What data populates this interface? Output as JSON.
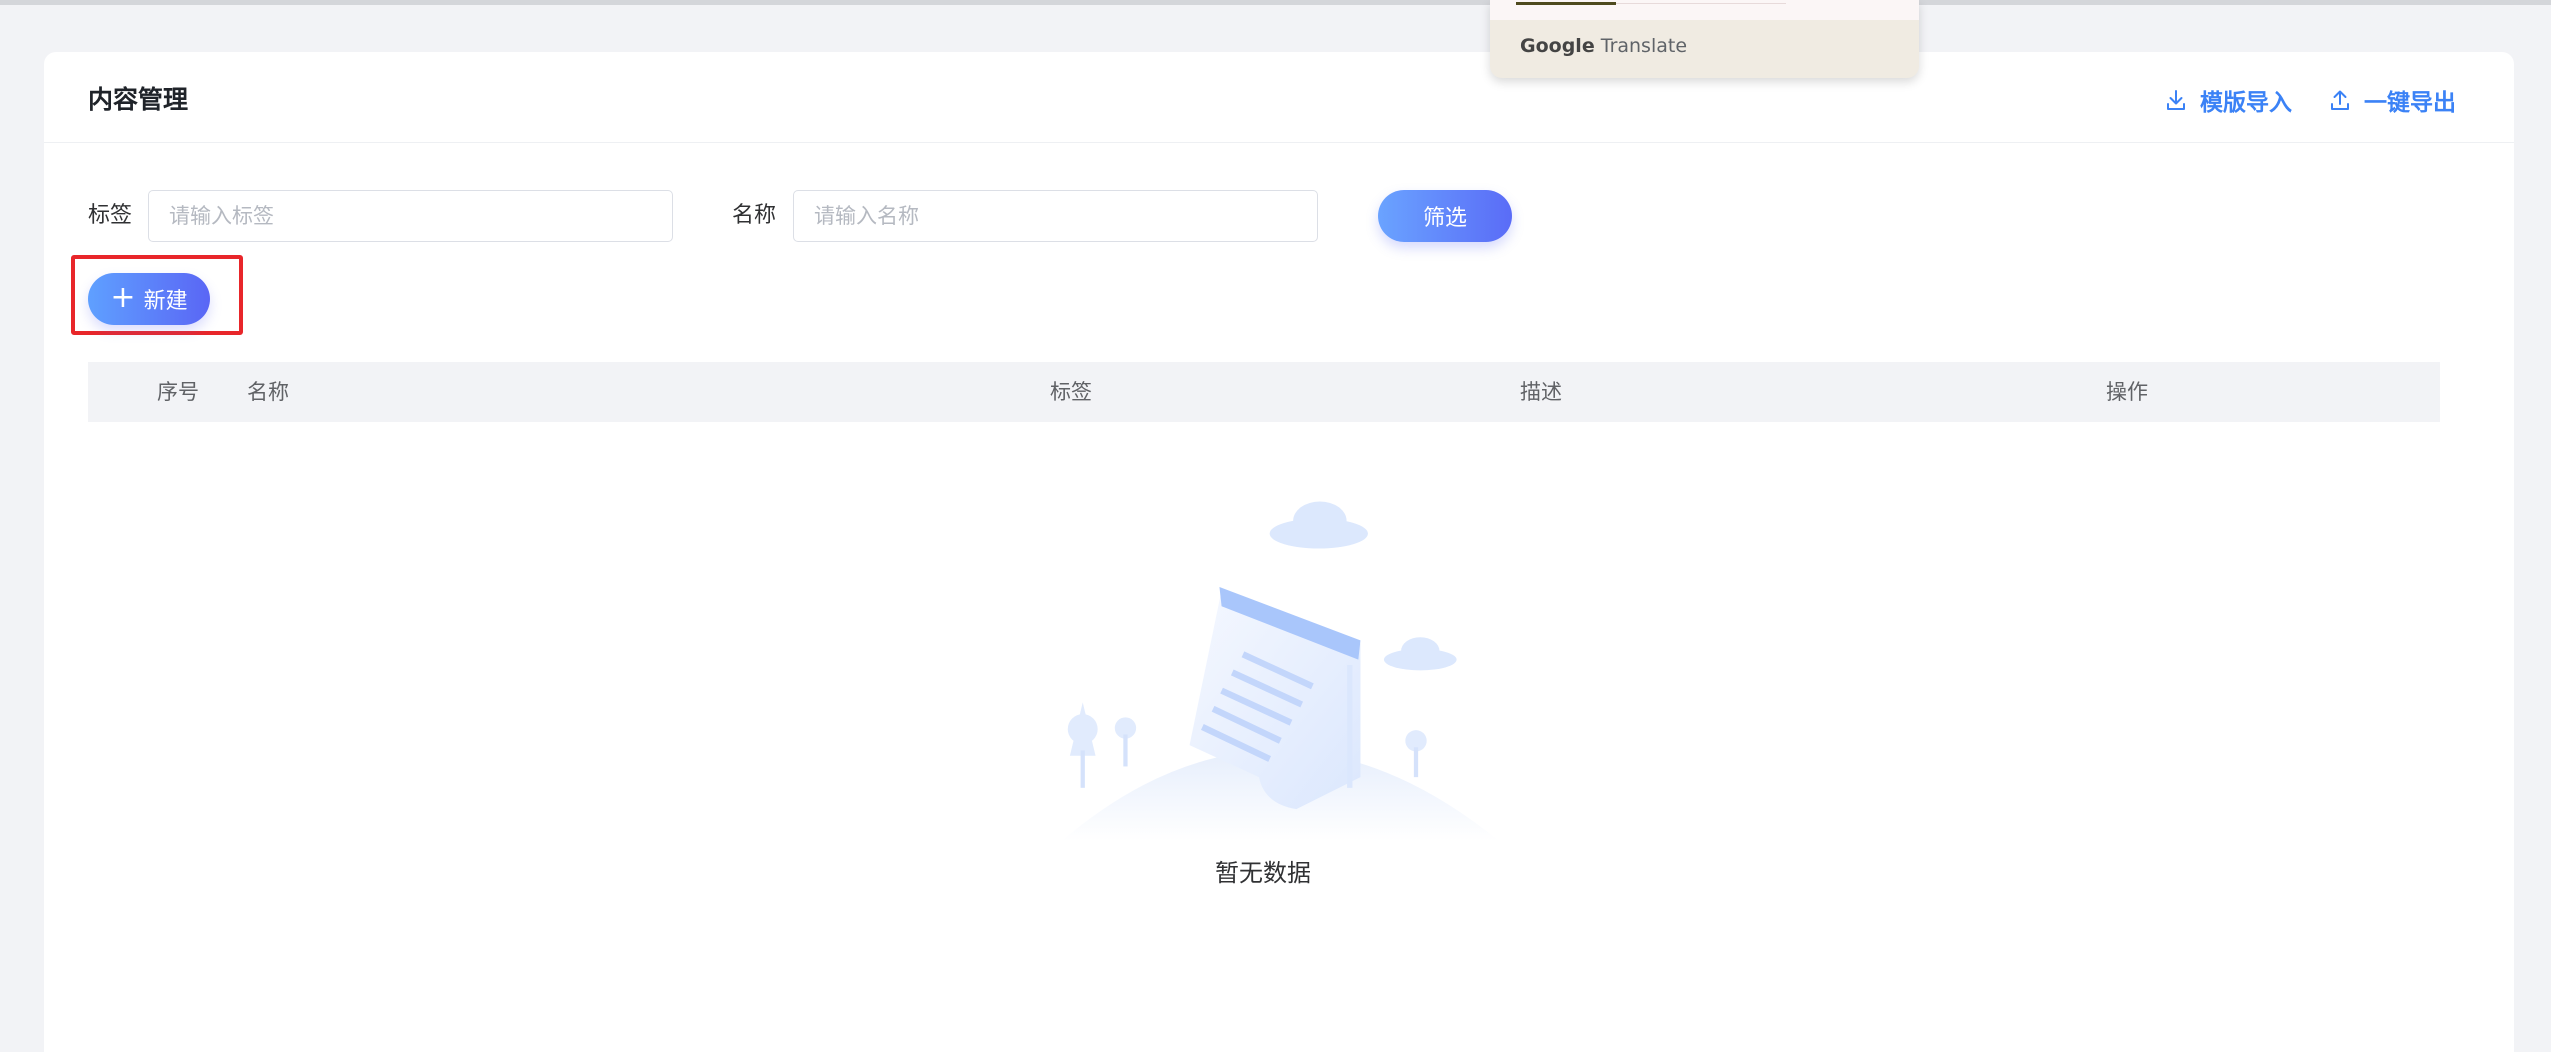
{
  "page": {
    "title": "内容管理"
  },
  "header": {
    "import_label": "模版导入",
    "export_label": "一键导出"
  },
  "filters": {
    "tag_label": "标签",
    "tag_placeholder": "请输入标签",
    "name_label": "名称",
    "name_placeholder": "请输入名称",
    "filter_button": "筛选"
  },
  "toolbar": {
    "new_label": "新建"
  },
  "table": {
    "columns": [
      "序号",
      "名称",
      "标签",
      "描述",
      "操作"
    ],
    "rows": [],
    "empty_text": "暂无数据"
  },
  "translate_popup": {
    "brand_google": "Google",
    "brand_translate": "Translate"
  },
  "colors": {
    "accent": "#3b82f6",
    "button_gradient_start": "#6aa3ff",
    "button_gradient_end": "#5a6cf7",
    "highlight": "#e8262a"
  }
}
